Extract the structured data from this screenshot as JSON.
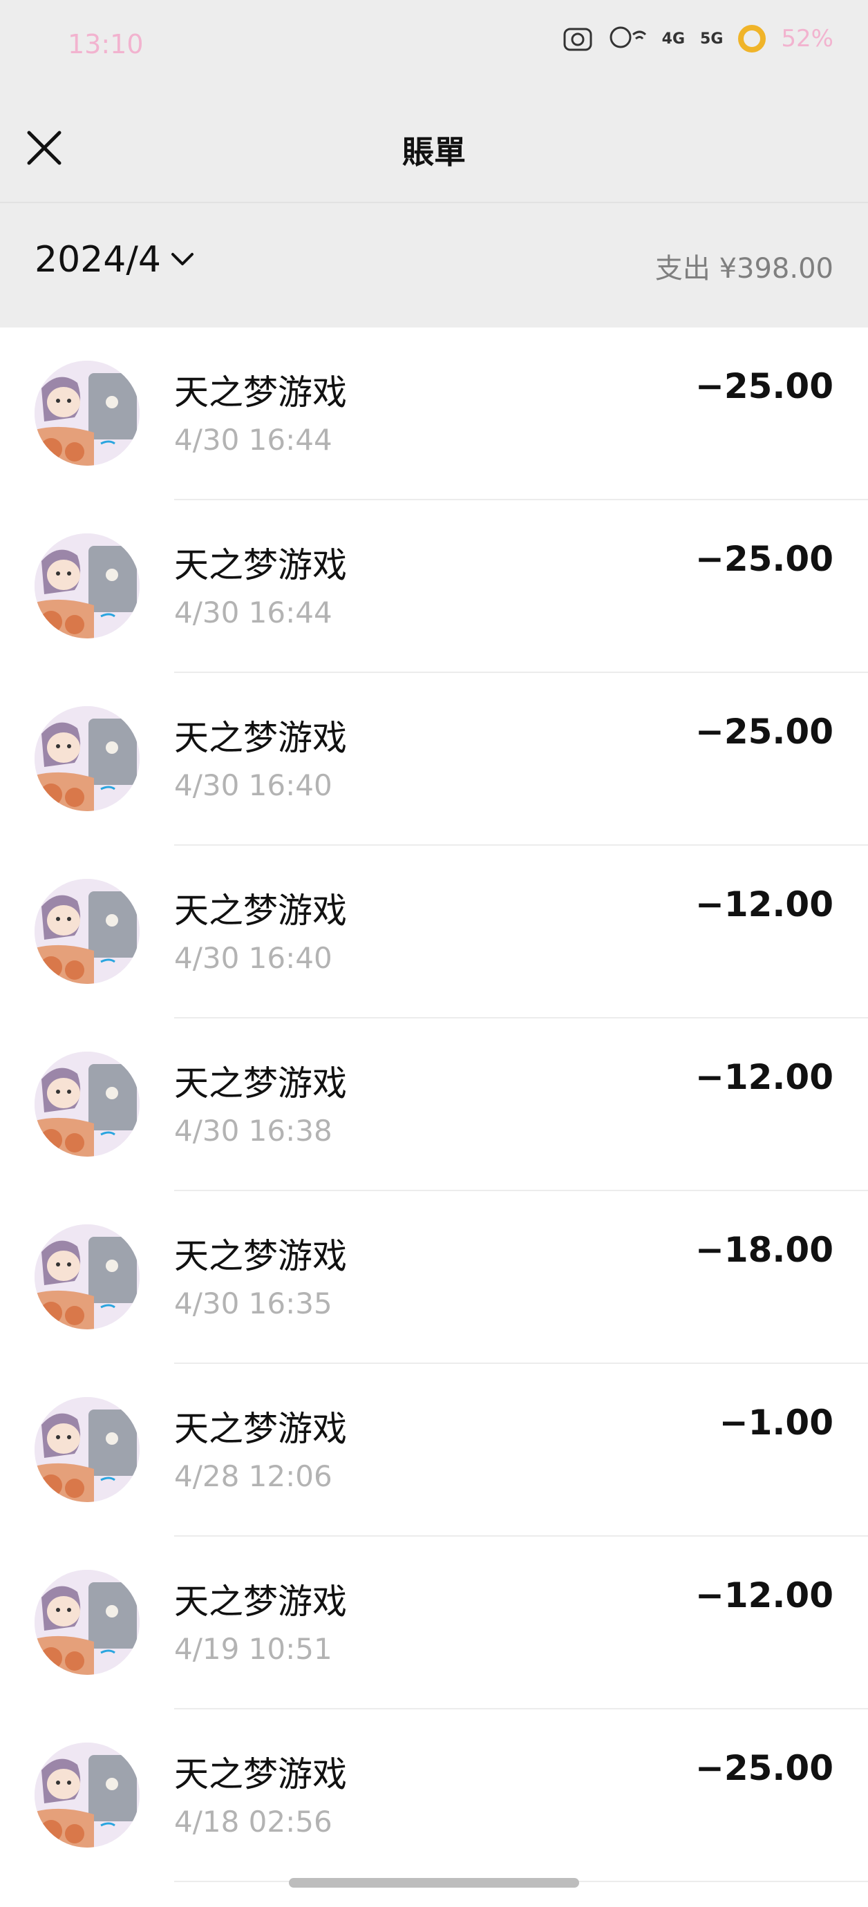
{
  "status_bar": {
    "time": "13:10",
    "network1": "4G",
    "network2": "5G",
    "battery": "52%",
    "icons": [
      "alarm-icon",
      "wifi-icon",
      "signal-4g-icon",
      "signal-5g-icon",
      "battery-icon"
    ]
  },
  "nav": {
    "title": "賬單",
    "close_icon": "close-icon"
  },
  "filter": {
    "month": "2024/4",
    "summary": "支出 ¥398.00"
  },
  "transactions": [
    {
      "merchant": "天之梦游戏",
      "time": "4/30 16:44",
      "amount": "−25.00"
    },
    {
      "merchant": "天之梦游戏",
      "time": "4/30 16:44",
      "amount": "−25.00"
    },
    {
      "merchant": "天之梦游戏",
      "time": "4/30 16:40",
      "amount": "−25.00"
    },
    {
      "merchant": "天之梦游戏",
      "time": "4/30 16:40",
      "amount": "−12.00"
    },
    {
      "merchant": "天之梦游戏",
      "time": "4/30 16:38",
      "amount": "−12.00"
    },
    {
      "merchant": "天之梦游戏",
      "time": "4/30 16:35",
      "amount": "−18.00"
    },
    {
      "merchant": "天之梦游戏",
      "time": "4/28 12:06",
      "amount": "−1.00"
    },
    {
      "merchant": "天之梦游戏",
      "time": "4/19 10:51",
      "amount": "−12.00"
    },
    {
      "merchant": "天之梦游戏",
      "time": "4/18 02:56",
      "amount": "−25.00"
    }
  ]
}
